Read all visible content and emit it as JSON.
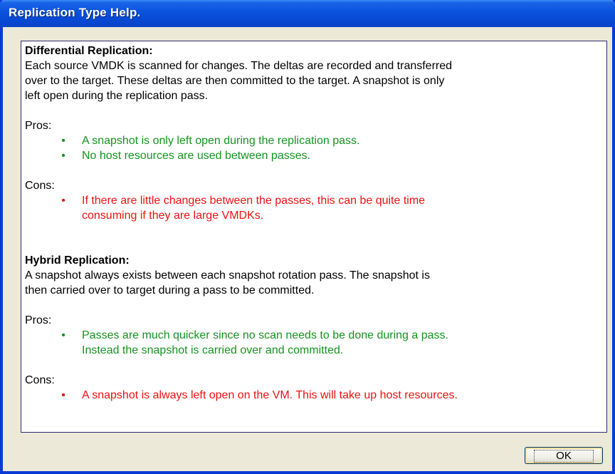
{
  "window": {
    "title": "Replication Type Help."
  },
  "sections": [
    {
      "heading": "Differential Replication:",
      "description": [
        "Each source VMDK is scanned for changes.  The deltas are recorded and transferred",
        "over to the target.  These deltas are then committed to the target.  A snapshot is only",
        "left open during the replication pass."
      ],
      "pros_label": "Pros:",
      "pros": [
        [
          "A snapshot is only left open during the replication pass."
        ],
        [
          "No host resources are used between passes."
        ]
      ],
      "cons_label": "Cons:",
      "cons": [
        [
          "If there are little changes between the passes, this can be quite time",
          "consuming if they are large VMDKs."
        ]
      ]
    },
    {
      "heading": "Hybrid Replication:",
      "description": [
        "A snapshot always exists between each snapshot rotation pass.  The snapshot is",
        "then carried over to target during a pass to be committed."
      ],
      "pros_label": "Pros:",
      "pros": [
        [
          "Passes are much quicker since no scan needs to be done during a pass.",
          "Instead the snapshot is carried over and committed."
        ]
      ],
      "cons_label": "Cons:",
      "cons": [
        [
          "A snapshot is always left open on the VM.  This will take up host resources."
        ]
      ]
    }
  ],
  "bullet_glyph": "•",
  "buttons": {
    "ok_label": "OK"
  },
  "colors": {
    "title_bar": "#0a52dc",
    "pros_text": "#14941f",
    "cons_text": "#ee1111",
    "dialog_background": "#ece9d8"
  }
}
